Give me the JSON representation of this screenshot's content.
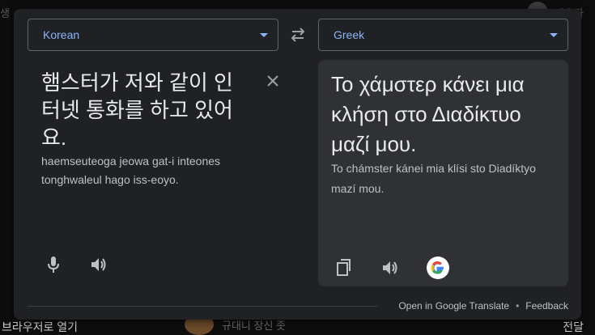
{
  "background": {
    "top_left_text": "생",
    "top_right_text": "갯유자",
    "bottom_left_text": "브라우저로 열기",
    "bottom_mid_text": "규대니 장신 좃",
    "bottom_right_text": "전달"
  },
  "translator": {
    "source_language": "Korean",
    "target_language": "Greek",
    "source_text": "햄스터가 저와 같이 인터넷 통화를 하고 있어요.",
    "source_transliteration": "haemseuteoga jeowa gat-i inteones tonghwaleul hago iss-eoyo.",
    "target_text": "Το χάμστερ κάνει μια κλήση στο Διαδίκτυο μαζί μου.",
    "target_transliteration": "To chámster kánei mia klísi sto Diadíktyo mazí mou.",
    "icons": {
      "swap": "swap-languages-icon",
      "clear": "close-icon",
      "mic": "microphone-icon",
      "speaker": "speaker-icon",
      "copy": "copy-icon",
      "google": "google-logo-icon"
    }
  },
  "footer": {
    "open_link": "Open in Google Translate",
    "separator": "•",
    "feedback_link": "Feedback"
  },
  "colors": {
    "accent": "#8ab4f8",
    "panel": "#303134",
    "popup": "#202124"
  }
}
